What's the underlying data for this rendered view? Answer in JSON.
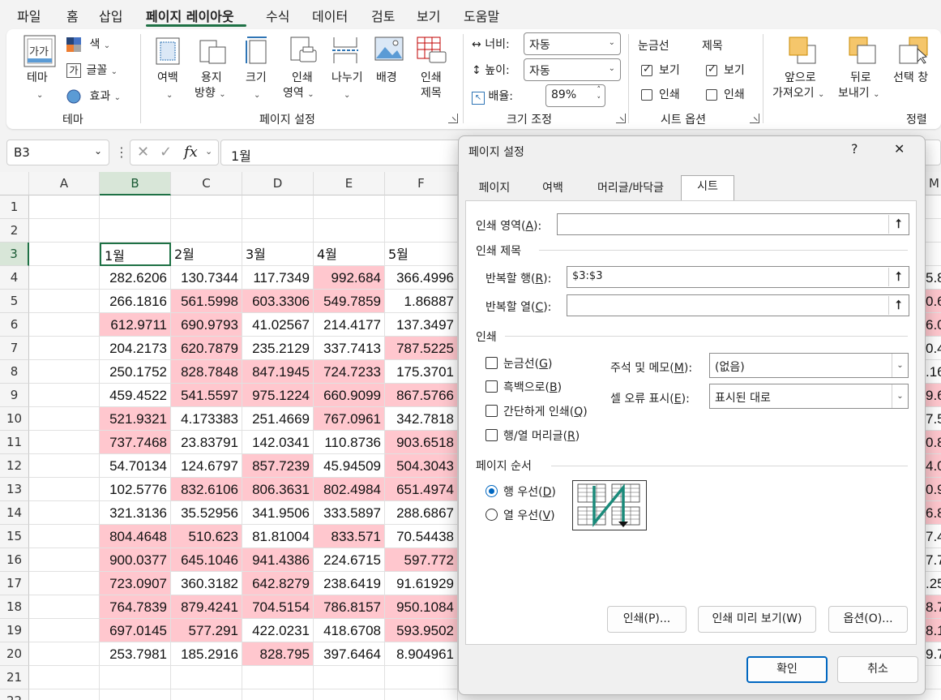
{
  "menu": {
    "items": [
      "파일",
      "홈",
      "삽입",
      "페이지 레이아웃",
      "수식",
      "데이터",
      "검토",
      "보기",
      "도움말"
    ],
    "active_index": 3
  },
  "ribbon": {
    "theme": {
      "main_label": "테마",
      "colors": "색",
      "fonts": "글꼴",
      "effects": "효과",
      "group": "테마"
    },
    "page_setup": {
      "margins": "여백",
      "orientation_1": "용지",
      "orientation_2": "방향",
      "size": "크기",
      "print_area_1": "인쇄",
      "print_area_2": "영역",
      "breaks": "나누기",
      "background": "배경",
      "print_titles_1": "인쇄",
      "print_titles_2": "제목",
      "group": "페이지 설정"
    },
    "scale": {
      "width_label": "너비:",
      "width_value": "자동",
      "height_label": "높이:",
      "height_value": "자동",
      "scale_label": "배율:",
      "scale_value": "89%",
      "group": "크기 조정"
    },
    "sheet_options": {
      "gridlines": "눈금선",
      "headings": "제목",
      "view": "보기",
      "print": "인쇄",
      "group": "시트 옵션"
    },
    "arrange": {
      "bring_forward_1": "앞으로",
      "bring_forward_2": "가져오기",
      "send_backward_1": "뒤로",
      "send_backward_2": "보내기",
      "selection_pane": "선택 창",
      "group": "정렬"
    }
  },
  "formula_bar": {
    "name_box": "B3",
    "fx": "fx",
    "content": "1월"
  },
  "grid": {
    "columns": [
      "A",
      "B",
      "C",
      "D",
      "E",
      "F"
    ],
    "partial_column": "M",
    "rows": [
      {
        "n": "1",
        "cells": [
          "",
          "",
          "",
          "",
          "",
          ""
        ]
      },
      {
        "n": "2",
        "cells": [
          "",
          "",
          "",
          "",
          "",
          ""
        ]
      },
      {
        "n": "3",
        "cells": [
          "",
          "1월",
          "2월",
          "3월",
          "4월",
          "5월"
        ],
        "edge": ""
      },
      {
        "n": "4",
        "cells": [
          "",
          "282.6206",
          "130.7344",
          "117.7349",
          "992.684",
          "366.4996"
        ],
        "edge": "5.8"
      },
      {
        "n": "5",
        "cells": [
          "",
          "266.1816",
          "561.5998",
          "603.3306",
          "549.7859",
          "1.86887"
        ],
        "edge": "0.6"
      },
      {
        "n": "6",
        "cells": [
          "",
          "612.9711",
          "690.9793",
          "41.02567",
          "214.4177",
          "137.3497"
        ],
        "edge": "6.0"
      },
      {
        "n": "7",
        "cells": [
          "",
          "204.2173",
          "620.7879",
          "235.2129",
          "337.7413",
          "787.5225"
        ],
        "edge": "0.4"
      },
      {
        "n": "8",
        "cells": [
          "",
          "250.1752",
          "828.7848",
          "847.1945",
          "724.7233",
          "175.3701"
        ],
        "edge": ".16"
      },
      {
        "n": "9",
        "cells": [
          "",
          "459.4522",
          "541.5597",
          "975.1224",
          "660.9099",
          "867.5766"
        ],
        "edge": "9.6"
      },
      {
        "n": "10",
        "cells": [
          "",
          "521.9321",
          "4.173383",
          "251.4669",
          "767.0961",
          "342.7818"
        ],
        "edge": "7.5"
      },
      {
        "n": "11",
        "cells": [
          "",
          "737.7468",
          "23.83791",
          "142.0341",
          "110.8736",
          "903.6518"
        ],
        "edge": "0.8"
      },
      {
        "n": "12",
        "cells": [
          "",
          "54.70134",
          "124.6797",
          "857.7239",
          "45.94509",
          "504.3043"
        ],
        "edge": "4.0"
      },
      {
        "n": "13",
        "cells": [
          "",
          "102.5776",
          "832.6106",
          "806.3631",
          "802.4984",
          "651.4974"
        ],
        "edge": "0.9"
      },
      {
        "n": "14",
        "cells": [
          "",
          "321.3136",
          "35.52956",
          "341.9506",
          "333.5897",
          "288.6867"
        ],
        "edge": "6.8"
      },
      {
        "n": "15",
        "cells": [
          "",
          "804.4648",
          "510.623",
          "81.81004",
          "833.571",
          "70.54438"
        ],
        "edge": "7.4"
      },
      {
        "n": "16",
        "cells": [
          "",
          "900.0377",
          "645.1046",
          "941.4386",
          "224.6715",
          "597.772"
        ],
        "edge": "7.7"
      },
      {
        "n": "17",
        "cells": [
          "",
          "723.0907",
          "360.3182",
          "642.8279",
          "238.6419",
          "91.61929"
        ],
        "edge": ".25"
      },
      {
        "n": "18",
        "cells": [
          "",
          "764.7839",
          "879.4241",
          "704.5154",
          "786.8157",
          "950.1084"
        ],
        "edge": "8.7"
      },
      {
        "n": "19",
        "cells": [
          "",
          "697.0145",
          "577.291",
          "422.0231",
          "418.6708",
          "593.9502"
        ],
        "edge": "8.1"
      },
      {
        "n": "20",
        "cells": [
          "",
          "253.7981",
          "185.2916",
          "828.795",
          "397.6464",
          "8.904961"
        ],
        "edge": "9.7"
      },
      {
        "n": "21",
        "cells": [
          "",
          "",
          "",
          "",
          "",
          ""
        ],
        "edge": ""
      },
      {
        "n": "22",
        "cells": [
          "",
          "",
          "",
          "",
          "",
          ""
        ],
        "edge": ""
      }
    ],
    "highlight_color": "#ffc7ce",
    "accent_color": "#1e7145"
  },
  "dialog": {
    "title": "페이지 설정",
    "help": "?",
    "close": "✕",
    "tabs": [
      "페이지",
      "여백",
      "머리글/바닥글",
      "시트"
    ],
    "active_tab": 3,
    "print_area_label": "인쇄 영역(",
    "print_area_key": "A",
    "print_area_value": "",
    "print_titles_heading": "인쇄 제목",
    "rows_repeat_label": "반복할 행(",
    "rows_repeat_key": "R",
    "rows_repeat_value": "$3:$3",
    "cols_repeat_label": "반복할 열(",
    "cols_repeat_key": "C",
    "cols_repeat_value": "",
    "print_heading": "인쇄",
    "print_options": [
      {
        "label": "눈금선(",
        "key": "G",
        "checked": false
      },
      {
        "label": "흑백으로(",
        "key": "B",
        "checked": false
      },
      {
        "label": "간단하게 인쇄(",
        "key": "Q",
        "checked": false
      },
      {
        "label": "행/열 머리글(",
        "key": "R",
        "checked": false
      }
    ],
    "comments_label": "주석 및 메모(",
    "comments_key": "M",
    "comments_value": "(없음)",
    "errors_label": "셀 오류 표시(",
    "errors_key": "E",
    "errors_value": "표시된 대로",
    "page_order_heading": "페이지 순서",
    "order_options": [
      {
        "label": "행 우선(",
        "key": "D",
        "selected": true
      },
      {
        "label": "열 우선(",
        "key": "V",
        "selected": false
      }
    ],
    "buttons": {
      "print": "인쇄(P)...",
      "preview": "인쇄 미리 보기(W)",
      "options": "옵션(O)...",
      "ok": "확인",
      "cancel": "취소"
    },
    "accent_color": "#0067c0"
  }
}
